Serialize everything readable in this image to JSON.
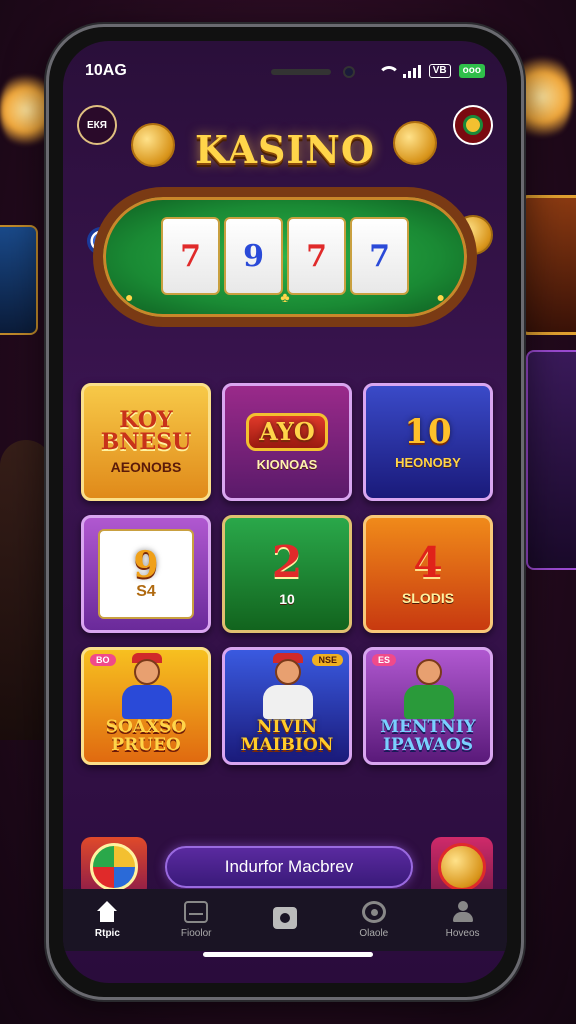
{
  "status_bar": {
    "time": "10AG",
    "network_badge": "VB",
    "battery": "ooo"
  },
  "hero": {
    "left_badge": "ЕКЯ",
    "title": "KASINO",
    "reels": [
      "7",
      "9",
      "7",
      "7"
    ]
  },
  "tiles": [
    {
      "big": "KOY BNESU",
      "small": "AEONOBS"
    },
    {
      "big": "AYO",
      "small": "KIONOAS"
    },
    {
      "big": "10",
      "small": "HEONOBY"
    },
    {
      "big": "9",
      "small": "S4"
    },
    {
      "big": "2",
      "small": "10"
    },
    {
      "big": "4",
      "small": "SLODIS"
    },
    {
      "big": "SOAXSO PRUEO",
      "tag": "BO"
    },
    {
      "big": "NIVIN MAIBION",
      "tag": "NSE"
    },
    {
      "big": "MENTNIY IPAWAOS",
      "tag": "ES"
    }
  ],
  "promo": {
    "button_label": "Indurfor Macbrev"
  },
  "nav": [
    {
      "label": "Rtpic",
      "icon": "home-icon"
    },
    {
      "label": "Fioolor",
      "icon": "tv-icon"
    },
    {
      "label": "",
      "icon": "camera-icon"
    },
    {
      "label": "Olaole",
      "icon": "chat-icon"
    },
    {
      "label": "Hoveos",
      "icon": "user-icon"
    }
  ],
  "colors": {
    "accent_gold": "#ffd54a",
    "felt_green": "#1a8a34",
    "screen_purple": "#3a1450",
    "battery_green": "#2fbf4a"
  }
}
